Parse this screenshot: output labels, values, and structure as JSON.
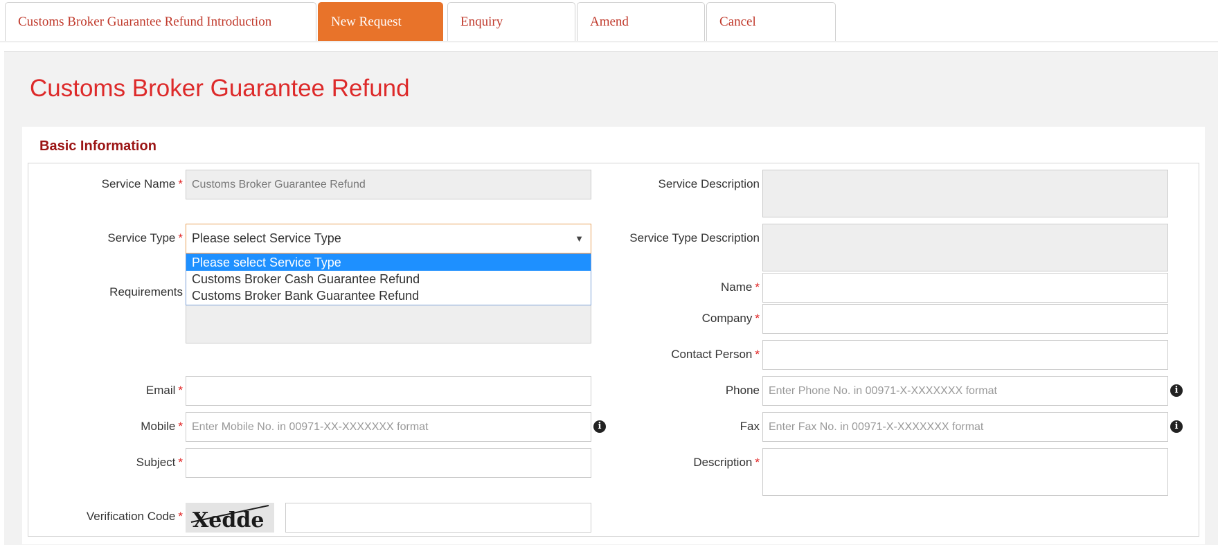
{
  "tabs": [
    {
      "label": "Customs Broker Guarantee Refund Introduction"
    },
    {
      "label": "New Request"
    },
    {
      "label": "Enquiry"
    },
    {
      "label": "Amend"
    },
    {
      "label": "Cancel"
    }
  ],
  "page_title": "Customs Broker Guarantee Refund",
  "section_title": "Basic Information",
  "form": {
    "service_name": {
      "label": "Service Name",
      "value": "Customs Broker Guarantee Refund"
    },
    "service_type": {
      "label": "Service Type",
      "selected": "Please select Service Type",
      "options": [
        "Please select Service Type",
        "Customs Broker Cash Guarantee Refund",
        "Customs Broker Bank Guarantee Refund"
      ]
    },
    "requirements": {
      "label": "Requirements"
    },
    "email": {
      "label": "Email"
    },
    "mobile": {
      "label": "Mobile",
      "placeholder": "Enter Mobile No. in 00971-XX-XXXXXXX format"
    },
    "subject": {
      "label": "Subject"
    },
    "verification_code": {
      "label": "Verification Code",
      "captcha_text": "Xedde"
    },
    "service_description": {
      "label": "Service Description"
    },
    "service_type_description": {
      "label": "Service Type Description"
    },
    "name": {
      "label": "Name"
    },
    "company": {
      "label": "Company"
    },
    "contact_person": {
      "label": "Contact Person"
    },
    "phone": {
      "label": "Phone",
      "placeholder": "Enter Phone No. in 00971-X-XXXXXXX format"
    },
    "fax": {
      "label": "Fax",
      "placeholder": "Enter Fax No. in 00971-X-XXXXXXX format"
    },
    "description": {
      "label": "Description"
    }
  },
  "required_mark": "*",
  "info_glyph": "i",
  "dropdown_arrow": "▼",
  "colors": {
    "accent": "#e8732a",
    "title": "#dd2a2a",
    "section": "#9b1414",
    "selected_option": "#1e90ff"
  }
}
